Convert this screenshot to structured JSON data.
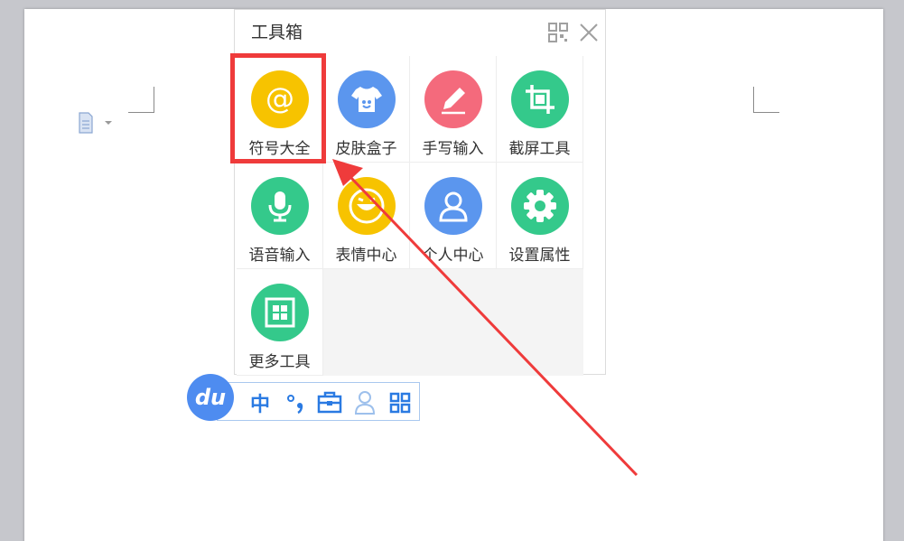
{
  "toolbox": {
    "title": "工具箱",
    "tools": [
      {
        "label": "符号大全",
        "icon": "at-sign-icon",
        "color": "#f7c300"
      },
      {
        "label": "皮肤盒子",
        "icon": "tshirt-icon",
        "color": "#5b96ee"
      },
      {
        "label": "手写输入",
        "icon": "pen-icon",
        "color": "#f46a7c"
      },
      {
        "label": "截屏工具",
        "icon": "crop-icon",
        "color": "#34c98b"
      },
      {
        "label": "语音输入",
        "icon": "microphone-icon",
        "color": "#34c98b"
      },
      {
        "label": "表情中心",
        "icon": "smile-icon",
        "color": "#f7c300"
      },
      {
        "label": "个人中心",
        "icon": "person-icon",
        "color": "#5b96ee"
      },
      {
        "label": "设置属性",
        "icon": "gear-icon",
        "color": "#34c98b"
      },
      {
        "label": "更多工具",
        "icon": "grid-icon",
        "color": "#34c98b"
      }
    ]
  },
  "ime_bar": {
    "logo_text": "du",
    "chinese_mode": "中",
    "accent_color": "#2a7ae2"
  },
  "annotation": {
    "highlight_color": "#ef3b3b"
  }
}
